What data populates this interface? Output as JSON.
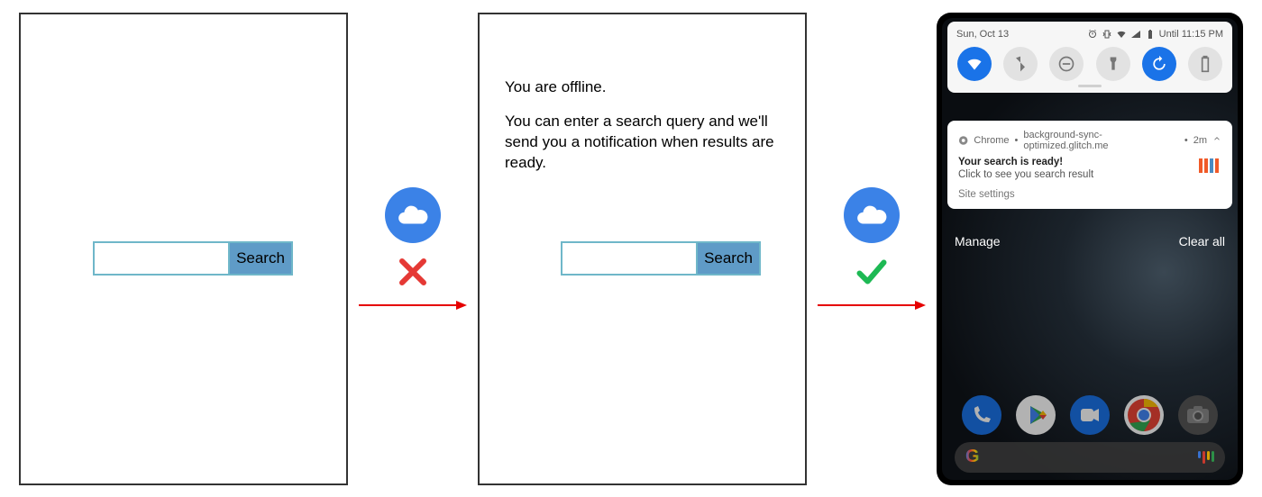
{
  "panels": {
    "initial": {
      "search_button": "Search"
    },
    "offline": {
      "title": "You are offline.",
      "message": "You can enter a search query and we'll send you a notification when results are ready.",
      "search_button": "Search"
    }
  },
  "connectors": {
    "first": {
      "status": "fail"
    },
    "second": {
      "status": "success"
    }
  },
  "phone": {
    "status_bar": {
      "date": "Sun, Oct 13",
      "until_text": "Until 11:15 PM"
    },
    "toggles": [
      "wifi",
      "bluetooth",
      "dnd",
      "flashlight",
      "rotate",
      "battery"
    ],
    "notification": {
      "app_label": "Chrome",
      "source": "background-sync-optimized.glitch.me",
      "time": "2m",
      "title": "Your search is ready!",
      "body": "Click to see you search result",
      "action": "Site settings"
    },
    "manage_row": {
      "left": "Manage",
      "right": "Clear all"
    },
    "dock": [
      "phone",
      "play",
      "duo",
      "chrome",
      "camera"
    ],
    "search_pill": {
      "label": "G"
    }
  },
  "colors": {
    "accent_blue": "#1a73e8",
    "cloud_blue": "#3b82e7",
    "fail_red": "#e53935",
    "success_green": "#1db954",
    "arrow_red": "#e60000",
    "search_border": "#6fb7c9",
    "search_button_bg": "#5f9bc7"
  }
}
